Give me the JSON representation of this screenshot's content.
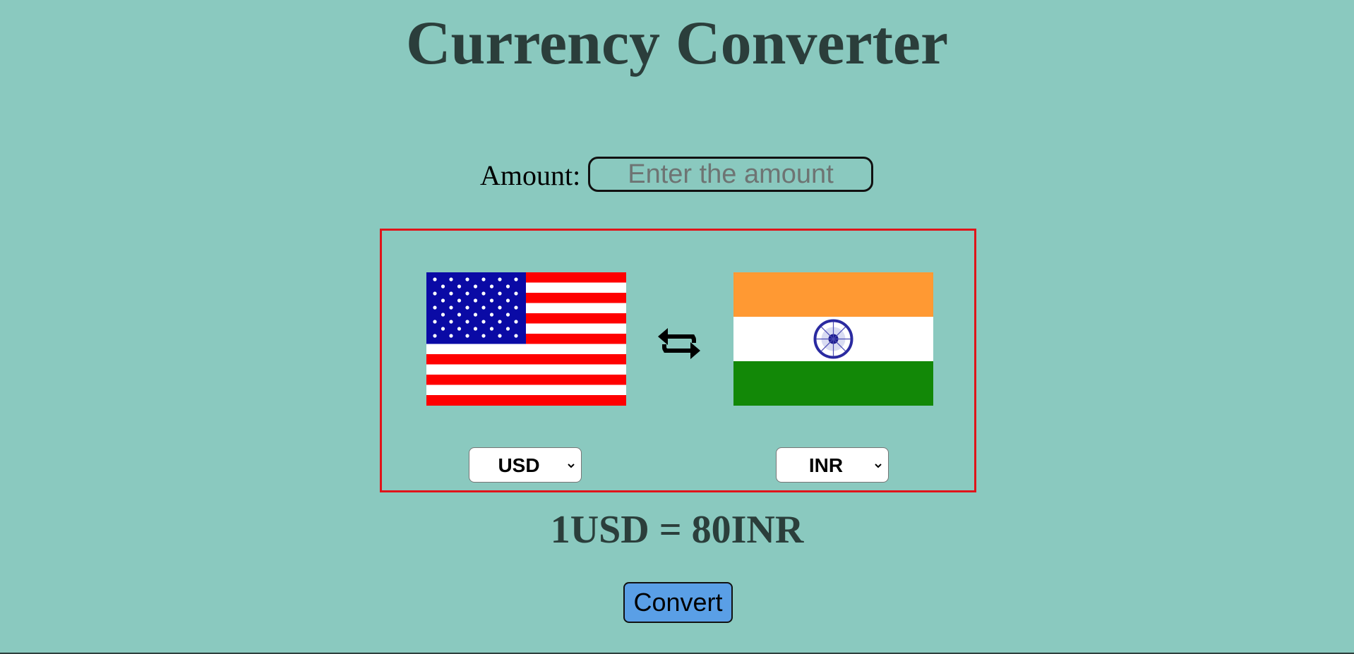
{
  "header": {
    "title": "Currency Converter"
  },
  "amount": {
    "label": "Amount:",
    "placeholder": "Enter the amount",
    "value": ""
  },
  "from_currency": {
    "code": "USD",
    "flag_icon": "us-flag-icon"
  },
  "to_currency": {
    "code": "INR",
    "flag_icon": "india-flag-icon"
  },
  "swap": {
    "icon": "swap-arrows-icon"
  },
  "rate": {
    "text": "1USD = 80INR"
  },
  "actions": {
    "convert_label": "Convert"
  },
  "colors": {
    "background": "#8ac9bf",
    "title": "#2b3e3b",
    "box_border": "#e0141a",
    "button": "#5a9fe6"
  }
}
